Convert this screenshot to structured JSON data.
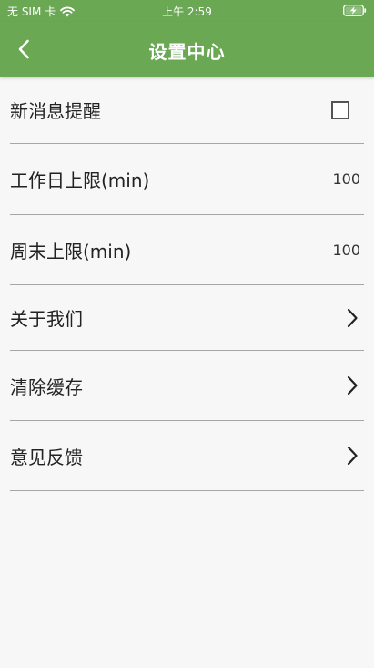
{
  "status_bar": {
    "carrier": "无 SIM 卡",
    "time": "上午 2:59",
    "wifi_icon": "wifi-icon",
    "battery_icon": "battery-charging-icon"
  },
  "header": {
    "title": "设置中心",
    "back_icon": "chevron-left-icon",
    "background_color": "#6aa854"
  },
  "settings": {
    "new_message_reminder": {
      "label": "新消息提醒",
      "checked": false
    },
    "workday_limit": {
      "label": "工作日上限(min)",
      "value": "100"
    },
    "weekend_limit": {
      "label": "周末上限(min)",
      "value": "100"
    },
    "about_us": {
      "label": "关于我们"
    },
    "clear_cache": {
      "label": "清除缓存"
    },
    "feedback": {
      "label": "意见反馈"
    }
  }
}
